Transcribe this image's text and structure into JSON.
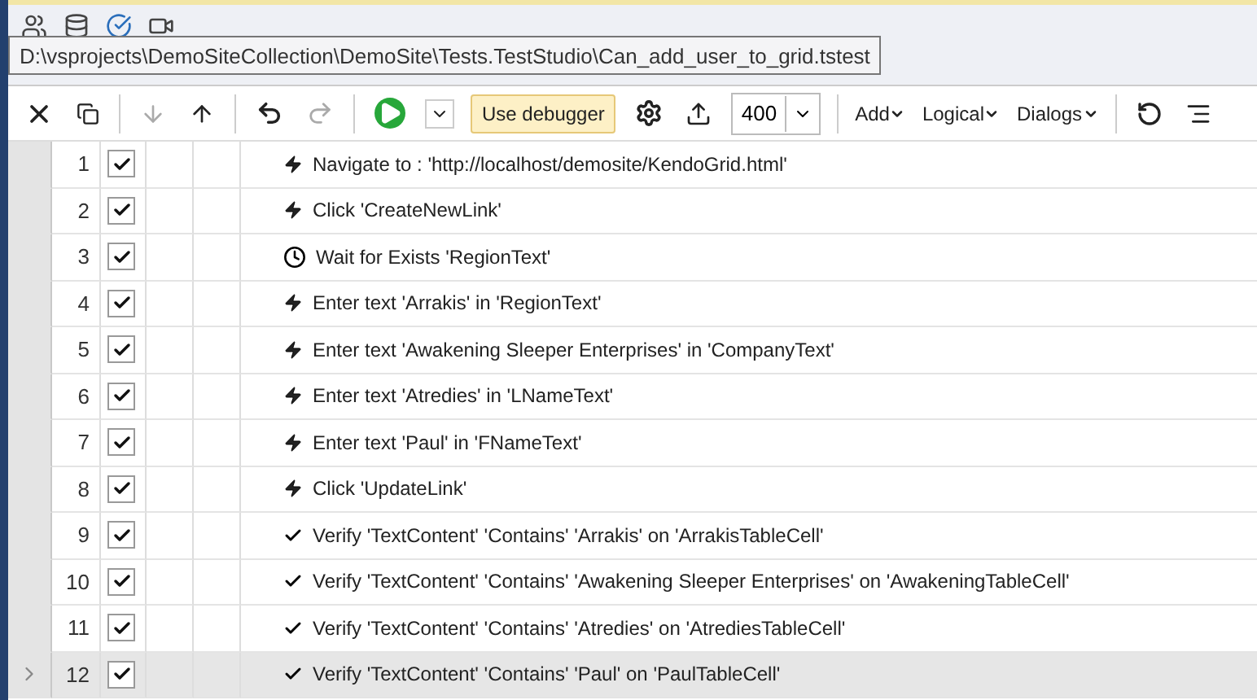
{
  "tooltip": {
    "text": "D:\\vsprojects\\DemoSiteCollection\\DemoSite\\Tests.TestStudio\\Can_add_user_to_grid.tstest"
  },
  "toolbar": {
    "debugger_button": "Use debugger",
    "zoom_value": "400",
    "menus": [
      "Add",
      "Logical",
      "Dialogs"
    ]
  },
  "steps": [
    {
      "number": "1",
      "checked": true,
      "kind": "action",
      "text": "Navigate to : 'http://localhost/demosite/KendoGrid.html'",
      "selected": false
    },
    {
      "number": "2",
      "checked": true,
      "kind": "action",
      "text": "Click 'CreateNewLink'",
      "selected": false
    },
    {
      "number": "3",
      "checked": true,
      "kind": "wait",
      "text": "Wait for Exists 'RegionText'",
      "selected": false
    },
    {
      "number": "4",
      "checked": true,
      "kind": "action",
      "text": "Enter text 'Arrakis' in 'RegionText'",
      "selected": false
    },
    {
      "number": "5",
      "checked": true,
      "kind": "action",
      "text": "Enter text 'Awakening Sleeper Enterprises' in 'CompanyText'",
      "selected": false
    },
    {
      "number": "6",
      "checked": true,
      "kind": "action",
      "text": "Enter text 'Atredies' in 'LNameText'",
      "selected": false
    },
    {
      "number": "7",
      "checked": true,
      "kind": "action",
      "text": "Enter text 'Paul' in 'FNameText'",
      "selected": false
    },
    {
      "number": "8",
      "checked": true,
      "kind": "action",
      "text": "Click 'UpdateLink'",
      "selected": false
    },
    {
      "number": "9",
      "checked": true,
      "kind": "verify",
      "text": "Verify 'TextContent' 'Contains' 'Arrakis' on 'ArrakisTableCell'",
      "selected": false
    },
    {
      "number": "10",
      "checked": true,
      "kind": "verify",
      "text": "Verify 'TextContent' 'Contains' 'Awakening Sleeper Enterprises' on 'AwakeningTableCell'",
      "selected": false
    },
    {
      "number": "11",
      "checked": true,
      "kind": "verify",
      "text": "Verify 'TextContent' 'Contains' 'Atredies' on 'AtrediesTableCell'",
      "selected": false
    },
    {
      "number": "12",
      "checked": true,
      "kind": "verify",
      "text": "Verify 'TextContent' 'Contains' 'Paul' on 'PaulTableCell'",
      "selected": true
    }
  ]
}
